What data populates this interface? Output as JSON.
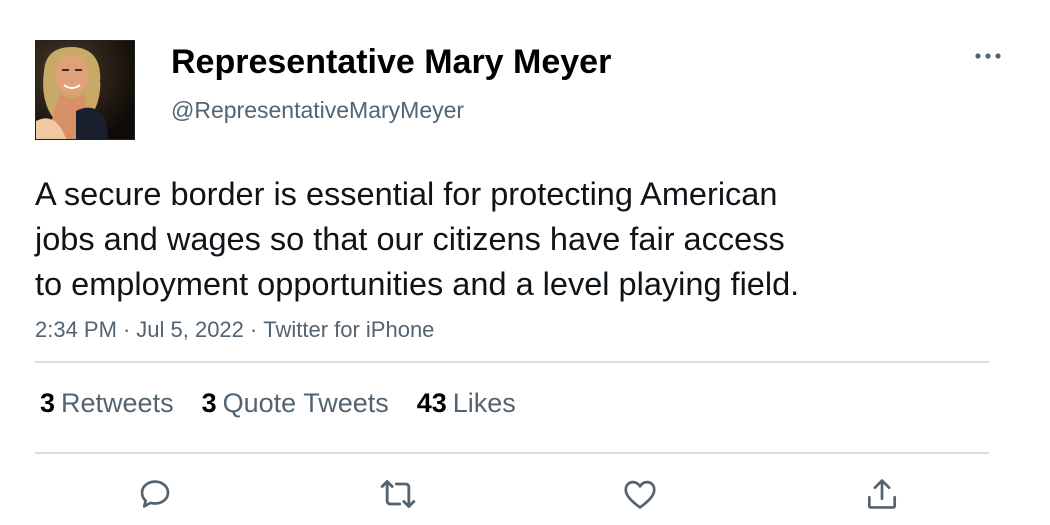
{
  "tweet": {
    "author": {
      "display_name": "Representative Mary Meyer",
      "handle": "@RepresentativeMaryMeyer",
      "avatar": "profile-photo"
    },
    "text_lines": [
      "A secure border is essential for protecting American",
      "jobs and wages so that our citizens have fair access",
      "to employment opportunities and a level playing field."
    ],
    "meta": {
      "time": "2:34 PM",
      "date": "Jul 5, 2022",
      "source": "Twitter for iPhone",
      "separator": "·"
    },
    "stats": {
      "retweets": {
        "count": "3",
        "label": "Retweets"
      },
      "quote_tweets": {
        "count": "3",
        "label": "Quote Tweets"
      },
      "likes": {
        "count": "43",
        "label": "Likes"
      }
    },
    "actions": [
      {
        "name": "reply",
        "icon": "reply-icon"
      },
      {
        "name": "retweet",
        "icon": "retweet-icon"
      },
      {
        "name": "like",
        "icon": "heart-icon"
      },
      {
        "name": "share",
        "icon": "share-icon"
      }
    ],
    "colors": {
      "secondary_text": "#536471",
      "primary_text": "#0f1419",
      "divider": "#dcdfe2"
    }
  }
}
